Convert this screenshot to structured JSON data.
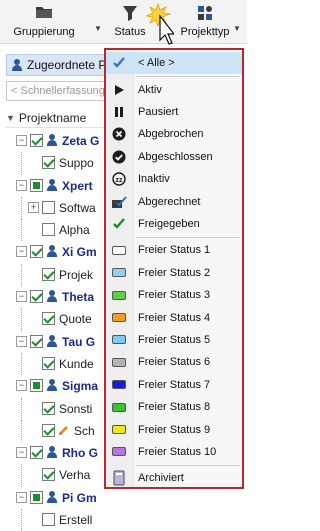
{
  "toolbar": {
    "group_label": "Gruppierung",
    "status_label": "Status",
    "type_label": "Projekttyp"
  },
  "assigned_tab": {
    "label": "Zugeordnete P"
  },
  "quick_filter": {
    "placeholder": "< Schnellerfassung"
  },
  "tree": {
    "header": "Projektname",
    "rows": [
      {
        "text": "Zeta G",
        "bold": true,
        "level": 0,
        "expander": "-",
        "check": "on",
        "icon": "person"
      },
      {
        "text": "Suppo",
        "bold": false,
        "level": 1,
        "expander": "",
        "check": "on",
        "icon": ""
      },
      {
        "text": "Xpert",
        "bold": true,
        "level": 0,
        "expander": "-",
        "check": "part",
        "icon": "person"
      },
      {
        "text": "Softwa",
        "bold": false,
        "level": 1,
        "expander": "+",
        "check": "off",
        "icon": ""
      },
      {
        "text": "Alpha",
        "bold": false,
        "level": 1,
        "expander": "",
        "check": "off",
        "icon": ""
      },
      {
        "text": "Xi Gm",
        "bold": true,
        "level": 0,
        "expander": "-",
        "check": "on",
        "icon": "person"
      },
      {
        "text": "Projek",
        "bold": false,
        "level": 1,
        "expander": "",
        "check": "on",
        "icon": ""
      },
      {
        "text": "Theta",
        "bold": true,
        "level": 0,
        "expander": "-",
        "check": "on",
        "icon": "person"
      },
      {
        "text": "Quote",
        "bold": false,
        "level": 1,
        "expander": "",
        "check": "on",
        "icon": ""
      },
      {
        "text": "Tau G",
        "bold": true,
        "level": 0,
        "expander": "-",
        "check": "on",
        "icon": "person"
      },
      {
        "text": "Kunde",
        "bold": false,
        "level": 1,
        "expander": "",
        "check": "on",
        "icon": ""
      },
      {
        "text": "Sigma",
        "bold": true,
        "level": 0,
        "expander": "-",
        "check": "part",
        "icon": "person"
      },
      {
        "text": "Sonsti",
        "bold": false,
        "level": 1,
        "expander": "",
        "check": "on",
        "icon": ""
      },
      {
        "text": "Sch",
        "bold": false,
        "level": 1,
        "expander": "",
        "check": "on",
        "icon": "pencil"
      },
      {
        "text": "Rho G",
        "bold": true,
        "level": 0,
        "expander": "-",
        "check": "on",
        "icon": "person"
      },
      {
        "text": "Verha",
        "bold": false,
        "level": 1,
        "expander": "",
        "check": "on",
        "icon": ""
      },
      {
        "text": "Pi Gm",
        "bold": true,
        "level": 0,
        "expander": "-",
        "check": "part",
        "icon": "person"
      },
      {
        "text": "Erstell",
        "bold": false,
        "level": 1,
        "expander": "",
        "check": "off",
        "icon": ""
      }
    ]
  },
  "status_menu": {
    "items": [
      {
        "label": "< Alle >",
        "icon": "check-icon",
        "selected": true
      },
      {
        "label": "Aktiv",
        "icon": "play-icon"
      },
      {
        "label": "Pausiert",
        "icon": "pause-icon"
      },
      {
        "label": "Abgebrochen",
        "icon": "cancel-circle-icon"
      },
      {
        "label": "Abgeschlossen",
        "icon": "done-circle-icon"
      },
      {
        "label": "Inaktiv",
        "icon": "sleep-icon"
      },
      {
        "label": "Abgerechnet",
        "icon": "billed-icon"
      },
      {
        "label": "Freigegeben",
        "icon": "approved-check-icon"
      },
      {
        "label": "Freier Status 1",
        "icon": "swatch-icon",
        "color": "#ffffff"
      },
      {
        "label": "Freier Status 2",
        "icon": "swatch-icon",
        "color": "#8fd3f4"
      },
      {
        "label": "Freier Status 3",
        "icon": "swatch-icon",
        "color": "#5fcf4a"
      },
      {
        "label": "Freier Status 4",
        "icon": "swatch-icon",
        "color": "#f59a23"
      },
      {
        "label": "Freier Status 5",
        "icon": "swatch-icon",
        "color": "#7fc8f5"
      },
      {
        "label": "Freier Status 6",
        "icon": "swatch-icon",
        "color": "#b5b5b5"
      },
      {
        "label": "Freier Status 7",
        "icon": "swatch-icon",
        "color": "#1a1ae6"
      },
      {
        "label": "Freier Status 8",
        "icon": "swatch-icon",
        "color": "#39c42e"
      },
      {
        "label": "Freier Status 9",
        "icon": "swatch-icon",
        "color": "#f2e61c"
      },
      {
        "label": "Freier Status 10",
        "icon": "swatch-icon",
        "color": "#b774e0"
      },
      {
        "label": "Archiviert",
        "icon": "archive-icon"
      }
    ]
  }
}
